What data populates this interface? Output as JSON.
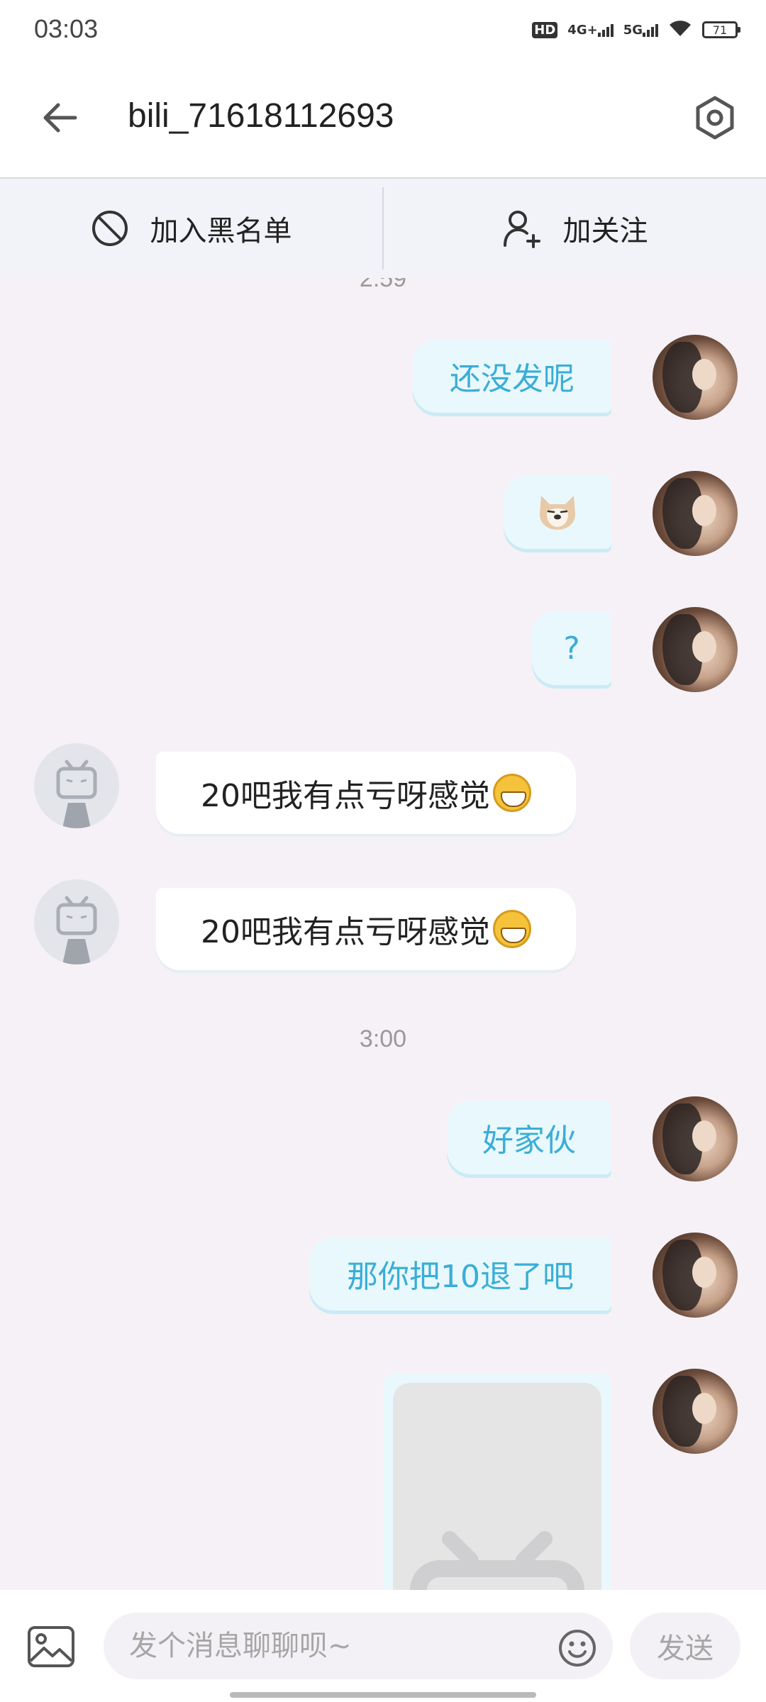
{
  "status_bar": {
    "time": "03:03",
    "hd_label": "HD",
    "network_4g": "4G+",
    "network_5g": "5G",
    "battery": "71"
  },
  "header": {
    "title": "bili_71618112693",
    "back_icon": "arrow-left-icon",
    "settings_icon": "hexagon-settings-icon"
  },
  "actions": {
    "blacklist_label": "加入黑名单",
    "follow_label": "加关注"
  },
  "chat": {
    "timestamps": [
      "2:59",
      "3:00"
    ],
    "messages": [
      {
        "sender": "me",
        "text": "还没发呢"
      },
      {
        "sender": "me",
        "type": "sticker",
        "icon": "shiba-dog-emoji"
      },
      {
        "sender": "me",
        "text": "?"
      },
      {
        "sender": "other",
        "text": "20吧我有点亏呀感觉",
        "emoji": "grinning-face-emoji"
      },
      {
        "sender": "other",
        "text": "20吧我有点亏呀感觉",
        "emoji": "grinning-face-emoji"
      },
      {
        "sender": "me",
        "text": "好家伙"
      },
      {
        "sender": "me",
        "text": "那你把10退了吧"
      },
      {
        "sender": "me",
        "type": "card",
        "icon": "bilibili-tv-placeholder-icon"
      }
    ]
  },
  "input": {
    "placeholder": "发个消息聊聊呗~",
    "send_label": "发送"
  },
  "colors": {
    "bubble_me_bg": "#e9f8fc",
    "bubble_me_text": "#3aaed6",
    "bubble_other_bg": "#ffffff",
    "chat_bg": "#f6f1f6"
  }
}
